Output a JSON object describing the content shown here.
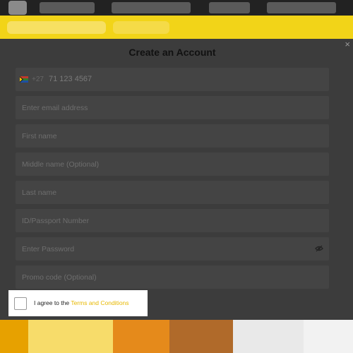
{
  "modal": {
    "title": "Create an Account",
    "close_label": "×"
  },
  "form": {
    "phone_code": "+27",
    "phone_placeholder": "71 123 4567",
    "email_placeholder": "Enter email address",
    "first_name_placeholder": "First name",
    "middle_name_placeholder": "Middle name (Optional)",
    "last_name_placeholder": "Last name",
    "id_placeholder": "ID/Passport Number",
    "password_placeholder": "Enter Password",
    "promo_placeholder": "Promo code (Optional)"
  },
  "agreement": {
    "prefix": "I agree to the",
    "link": "Terms and Conditions"
  },
  "icons": {
    "flag": "south-africa-flag-icon",
    "password_toggle": "eye-slash-icon",
    "close": "close-icon"
  },
  "colors": {
    "link": "#e7b800",
    "banner": "#f2d418",
    "modal_bg": "#3c3c3c"
  }
}
